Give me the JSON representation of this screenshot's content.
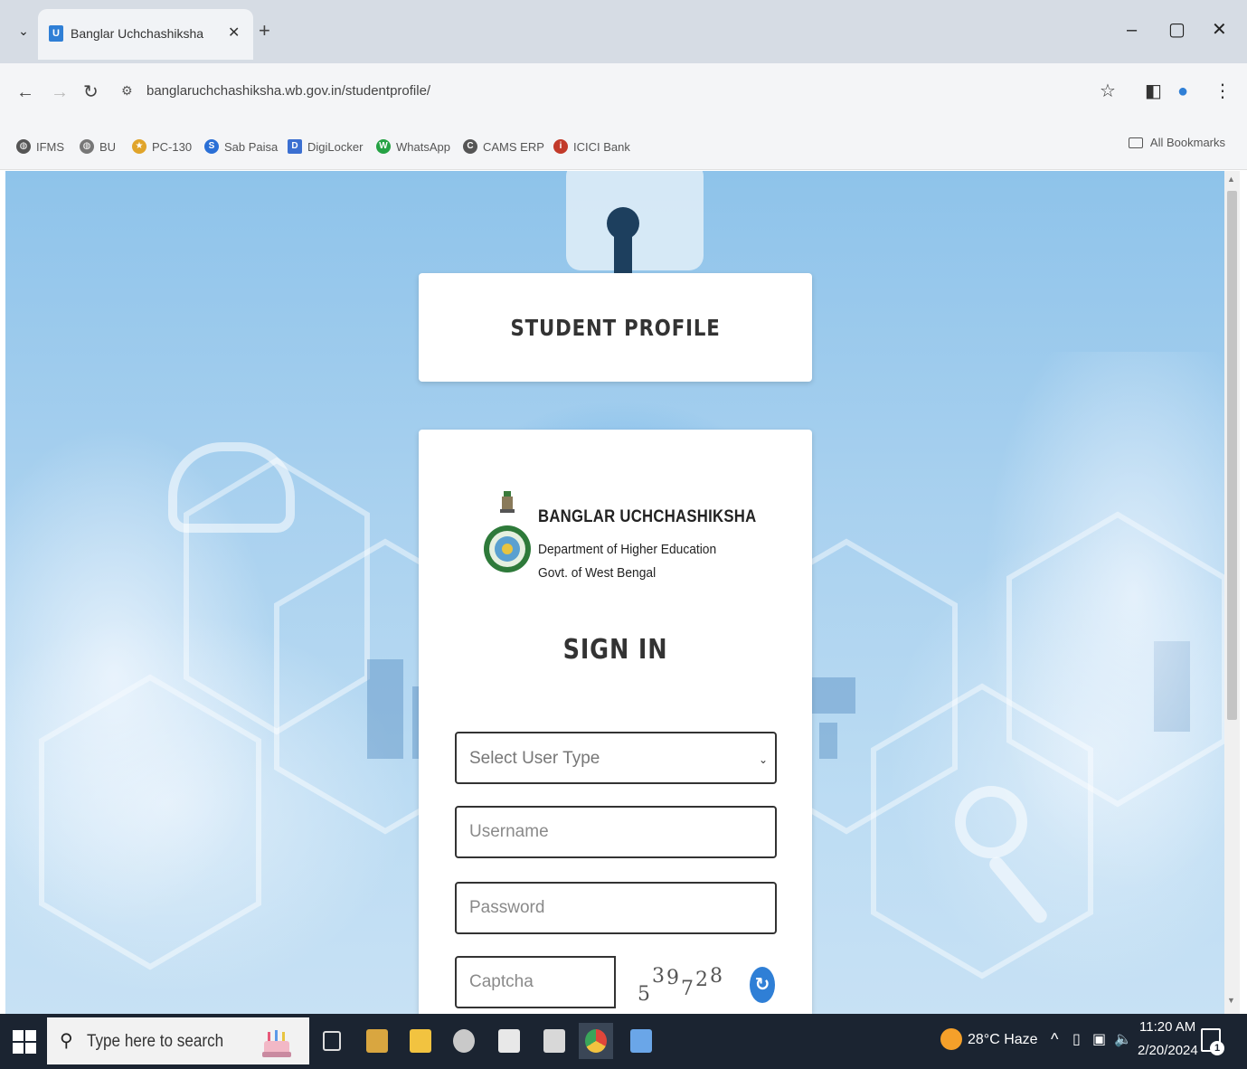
{
  "browser": {
    "tab_title": "Banglar Uchchashiksha",
    "tab_favicon": "U",
    "url": "banglaruchchashiksha.wb.gov.in/studentprofile/",
    "all_bookmarks": "All Bookmarks",
    "bookmarks": [
      {
        "label": "IFMS",
        "color": "#555555",
        "icon": "globe-icon"
      },
      {
        "label": "BU",
        "color": "#777777",
        "icon": "globe-icon"
      },
      {
        "label": "PC-130",
        "color": "#e0a42a",
        "icon": "star-icon"
      },
      {
        "label": "Sab Paisa",
        "color": "#2a6fd6",
        "icon": "sabpaisa-icon"
      },
      {
        "label": "DigiLocker",
        "color": "#3b6fd1",
        "icon": "digilocker-icon"
      },
      {
        "label": "WhatsApp",
        "color": "#25a244",
        "icon": "whatsapp-icon"
      },
      {
        "label": "CAMS ERP",
        "color": "#555555",
        "icon": "cams-icon"
      },
      {
        "label": "ICICI Bank",
        "color": "#c23a2a",
        "icon": "icici-icon"
      }
    ]
  },
  "page": {
    "header_title": "STUDENT PROFILE",
    "brand_name": "BANGLAR UCHCHASHIKSHA",
    "brand_dept": "Department of Higher Education",
    "brand_govt": "Govt. of West Bengal",
    "signin_title": "SIGN IN",
    "user_type_placeholder": "Select User Type",
    "username_placeholder": "Username",
    "password_placeholder": "Password",
    "captcha_placeholder": "Captcha",
    "captcha_chars": [
      "5",
      "3",
      "9",
      "7",
      "2",
      "8"
    ]
  },
  "taskbar": {
    "search_placeholder": "Type here to search",
    "weather": "28°C  Haze",
    "time": "11:20 AM",
    "date": "2/20/2024",
    "notification_count": "1"
  },
  "colors": {
    "accent_blue": "#2f7fd6",
    "taskbar_bg": "#1b2431"
  }
}
